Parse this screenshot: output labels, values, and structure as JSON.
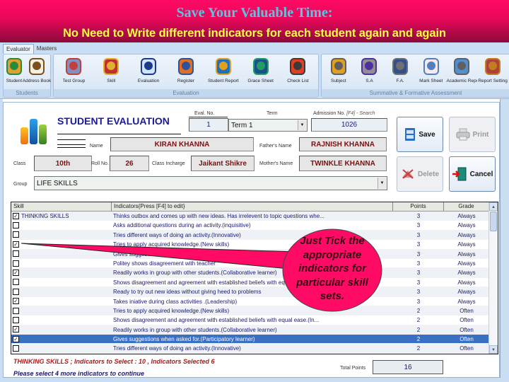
{
  "banner": {
    "title": "Save Your Valuable Time:",
    "subtitle": "No Need to Write different indicators for each student again and again"
  },
  "ribbon": {
    "tabs": [
      {
        "label": "Evaluator",
        "active": true
      },
      {
        "label": "Masters",
        "active": false
      }
    ],
    "groups": [
      {
        "label": "Students",
        "buttons": [
          {
            "label": "Student",
            "icon": "users-icon"
          },
          {
            "label": "Address Book",
            "icon": "clipboard-icon"
          }
        ]
      },
      {
        "label": "Evaluation",
        "buttons": [
          {
            "label": "Test Group",
            "icon": "test-group-icon"
          },
          {
            "label": "Skill",
            "icon": "brushes-icon"
          },
          {
            "label": "Evaluation",
            "icon": "checklist-pen-icon"
          },
          {
            "label": "Register",
            "icon": "user-search-icon"
          },
          {
            "label": "Student Report",
            "icon": "phone-globe-icon"
          },
          {
            "label": "Grace Sheet",
            "icon": "messenger-user-icon"
          },
          {
            "label": "Check List",
            "icon": "floppy-icon"
          }
        ]
      },
      {
        "label": "Summative & Formative Assessment",
        "buttons": [
          {
            "label": "Subject",
            "icon": "film-reel-icon"
          },
          {
            "label": "S.A",
            "icon": "music-note-icon"
          },
          {
            "label": "F.A.",
            "icon": "camcorder-icon"
          },
          {
            "label": "Mark Sheet",
            "icon": "clipboard-sheet-icon"
          },
          {
            "label": "Academic Report",
            "icon": "media-report-icon"
          },
          {
            "label": "Report Setting",
            "icon": "cube-network-icon"
          }
        ]
      }
    ]
  },
  "form": {
    "title": "STUDENT EVALUATION",
    "eval_no": {
      "label": "Eval. No.",
      "value": "1"
    },
    "term": {
      "label": "Term",
      "value": "Term 1"
    },
    "admission_no": {
      "label": "Admission No.",
      "hint": "[F4] - Search",
      "value": "1026"
    },
    "name": {
      "label": "Name",
      "value": "KIRAN KHANNA"
    },
    "fathers_name": {
      "label": "Father's Name",
      "value": "RAJNISH KHANNA"
    },
    "class": {
      "label": "Class",
      "value": "10th"
    },
    "roll_no": {
      "label": "Roll No.",
      "value": "26"
    },
    "class_incharge": {
      "label": "Class Incharge",
      "value": "Jaikant Shikre"
    },
    "mothers_name": {
      "label": "Mother's Name",
      "value": "TWINKLE KHANNA"
    },
    "group": {
      "label": "Group",
      "value": "LIFE SKILLS"
    }
  },
  "actions": {
    "save": "Save",
    "print": "Print",
    "delete": "Delete",
    "cancel": "Cancel"
  },
  "grid": {
    "columns": [
      "Skill",
      "Indicators{Press [F4] to edit}",
      "Points",
      "Grade"
    ],
    "rows": [
      {
        "checked": true,
        "skill": "THINKING SKILLS",
        "indicator": "Thinks outbox and comes up with new ideas. Has irrelevent to topic questions whe...",
        "points": "3",
        "grade": "Always",
        "selected": false
      },
      {
        "checked": false,
        "skill": "",
        "indicator": "Asks additional questions during an activity.(inquisitive)",
        "points": "3",
        "grade": "Always",
        "selected": false
      },
      {
        "checked": false,
        "skill": "",
        "indicator": "Tries different ways of doing an activity.(Innovative)",
        "points": "3",
        "grade": "Always",
        "selected": false
      },
      {
        "checked": true,
        "skill": "",
        "indicator": "Tries to apply acquired knowledge.(New skills)",
        "points": "3",
        "grade": "Always",
        "selected": false
      },
      {
        "checked": false,
        "skill": "",
        "indicator": "Gives suggestions when asked for.(Participatory learner)",
        "points": "3",
        "grade": "Always",
        "selected": false
      },
      {
        "checked": false,
        "skill": "",
        "indicator": "Politey shows disagreement with teacher",
        "points": "3",
        "grade": "Always",
        "selected": false
      },
      {
        "checked": true,
        "skill": "",
        "indicator": "Readily works in group with other students.(Collaborative learner)",
        "points": "3",
        "grade": "Always",
        "selected": false
      },
      {
        "checked": false,
        "skill": "",
        "indicator": "Shows disagreement and agreement with established beliefs with equal ease.",
        "points": "3",
        "grade": "Always",
        "selected": false
      },
      {
        "checked": false,
        "skill": "",
        "indicator": "Ready to try out new ideas without giving heed to problems",
        "points": "3",
        "grade": "Always",
        "selected": false
      },
      {
        "checked": true,
        "skill": "",
        "indicator": "Takes iniative during class activities .(Leadership)",
        "points": "3",
        "grade": "Always",
        "selected": false
      },
      {
        "checked": false,
        "skill": "",
        "indicator": "Tries to apply acquired knowledge.(New skills)",
        "points": "2",
        "grade": "Often",
        "selected": false
      },
      {
        "checked": false,
        "skill": "",
        "indicator": "Shows disagreement and agreement with established beliefs with equal ease.(In...",
        "points": "2",
        "grade": "Often",
        "selected": false
      },
      {
        "checked": true,
        "skill": "",
        "indicator": "Readily works in group with other students.(Collaborative learner)",
        "points": "2",
        "grade": "Often",
        "selected": false
      },
      {
        "checked": true,
        "skill": "",
        "indicator": "Gives suggestions when asked for.(Participatory learner)",
        "points": "2",
        "grade": "Often",
        "selected": true
      },
      {
        "checked": false,
        "skill": "",
        "indicator": "Tries different ways of doing an activity.(Innovative)",
        "points": "2",
        "grade": "Often",
        "selected": false
      }
    ]
  },
  "status": {
    "line1": "THINKING SKILLS ;  Indicators to Select  :  10 , Indicators Selected     6",
    "line2": "Please select  4 more indicators to continue",
    "total_points_label": "Total Points",
    "total_points": "16"
  },
  "callout": {
    "text": "Just Tick the appropriate indicators for particular skill sets.",
    "color": "#ff0a64"
  }
}
